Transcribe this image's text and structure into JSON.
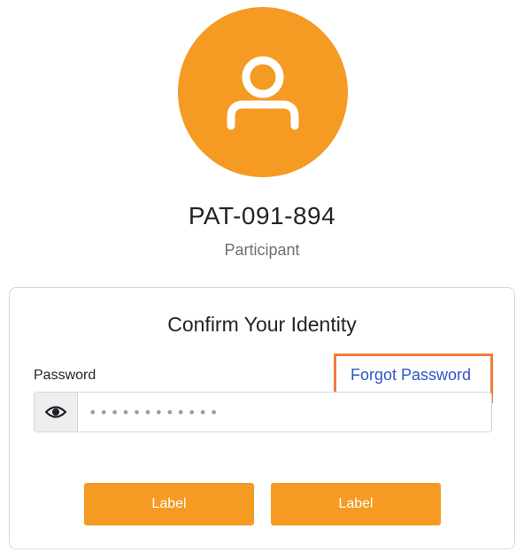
{
  "profile": {
    "id": "PAT-091-894",
    "role": "Participant",
    "avatar_icon": "user-icon",
    "avatar_color": "#f59a23"
  },
  "card": {
    "title": "Confirm Your Identity",
    "password_label": "Password",
    "forgot_link": "Forgot Password",
    "password_value": "••••••••••••",
    "toggle_icon": "eye-icon"
  },
  "buttons": {
    "left_label": "Label",
    "right_label": "Label",
    "color": "#f59a23"
  },
  "highlight": {
    "color": "#f37a3b"
  }
}
